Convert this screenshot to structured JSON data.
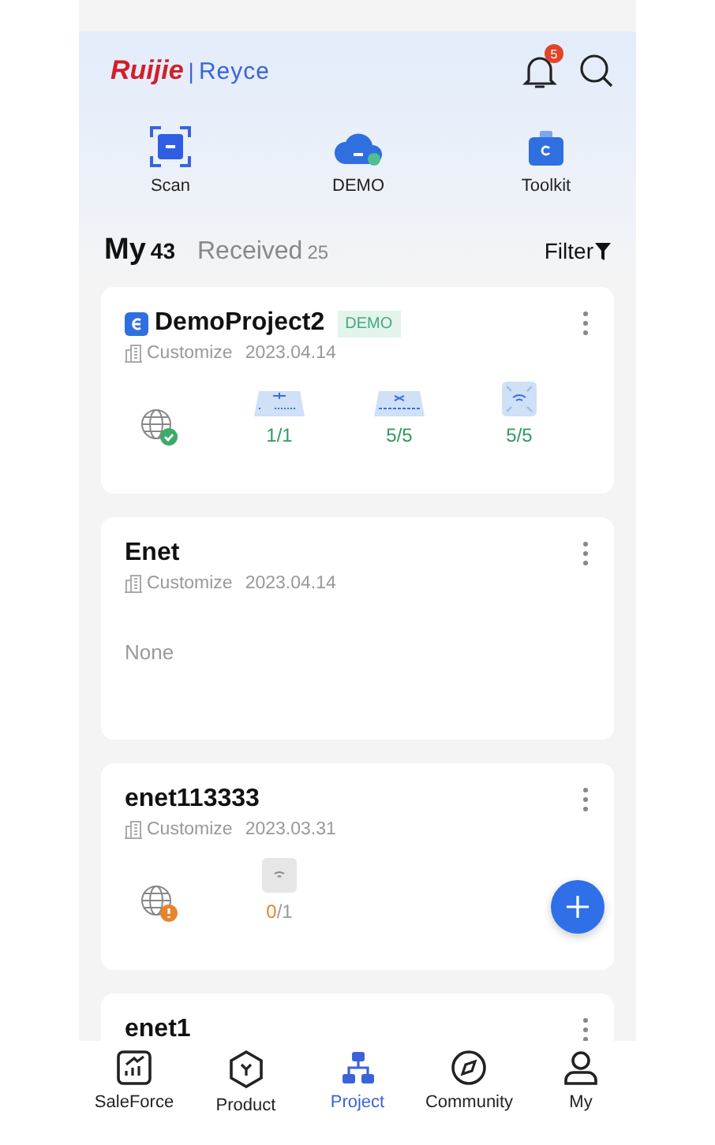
{
  "header": {
    "brand": "Ruijie",
    "separator": "|",
    "product": "Reyce",
    "notifications": "5"
  },
  "shortcuts": [
    {
      "kind": "scan",
      "label": "Scan"
    },
    {
      "kind": "cloud",
      "label": "DEMO"
    },
    {
      "kind": "toolkit",
      "label": "Toolkit"
    }
  ],
  "tabs": [
    {
      "label": "My",
      "count": "43",
      "selected": true
    },
    {
      "label": "Received",
      "count": "25",
      "selected": false
    }
  ],
  "filter": "Filter",
  "projects": [
    {
      "name": "DemoProject2",
      "logo": true,
      "badge": "DEMO",
      "type": "Customize",
      "date": "2023.04.14",
      "gateway_alert": false,
      "devices": [
        {
          "kind": "router",
          "online": "1",
          "total": "/1",
          "alert": false
        },
        {
          "kind": "switch",
          "online": "5",
          "total": "/5",
          "alert": false
        },
        {
          "kind": "ap",
          "online": "5",
          "total": "/5",
          "alert": false
        }
      ]
    },
    {
      "name": "Enet",
      "logo": false,
      "type": "Customize",
      "date": "2023.04.14",
      "empty": "None"
    },
    {
      "name": "enet113333",
      "logo": false,
      "type": "Customize",
      "date": "2023.03.31",
      "gateway_alert": true,
      "devices": [
        {
          "kind": "ap-grey",
          "online": "0",
          "total": "/1",
          "alert": true
        }
      ]
    },
    {
      "name": "enet1",
      "logo": false
    }
  ],
  "nav": [
    {
      "kind": "chart",
      "label": "SaleForce",
      "selected": false
    },
    {
      "kind": "hexagon",
      "label": "Product",
      "selected": false
    },
    {
      "kind": "network",
      "label": "Project",
      "selected": true
    },
    {
      "kind": "compass",
      "label": "Community",
      "selected": false
    },
    {
      "kind": "person",
      "label": "My",
      "selected": false
    }
  ]
}
